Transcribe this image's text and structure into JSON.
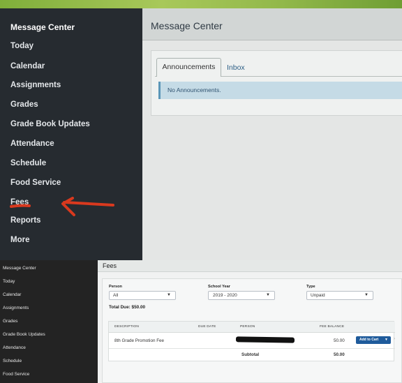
{
  "top": {
    "sidebar": {
      "items": [
        {
          "label": "Message Center"
        },
        {
          "label": "Today"
        },
        {
          "label": "Calendar"
        },
        {
          "label": "Assignments"
        },
        {
          "label": "Grades"
        },
        {
          "label": "Grade Book Updates"
        },
        {
          "label": "Attendance"
        },
        {
          "label": "Schedule"
        },
        {
          "label": "Food Service"
        },
        {
          "label": "Fees"
        },
        {
          "label": "Reports"
        },
        {
          "label": "More"
        }
      ]
    },
    "header": {
      "title": "Message Center"
    },
    "tabs": [
      {
        "label": "Announcements"
      },
      {
        "label": "Inbox"
      }
    ],
    "alert": "No Announcements.",
    "annotation_color": "#d9391e"
  },
  "bottom": {
    "sidebar": {
      "items": [
        {
          "label": "Message Center"
        },
        {
          "label": "Today"
        },
        {
          "label": "Calendar"
        },
        {
          "label": "Assignments"
        },
        {
          "label": "Grades"
        },
        {
          "label": "Grade Book Updates"
        },
        {
          "label": "Attendance"
        },
        {
          "label": "Schedule"
        },
        {
          "label": "Food Service"
        }
      ]
    },
    "header": {
      "title": "Fees"
    },
    "filters": {
      "person": {
        "label": "Person",
        "value": "All"
      },
      "school_year": {
        "label": "School Year",
        "value": "2019 - 2020"
      },
      "type": {
        "label": "Type",
        "value": "Unpaid"
      }
    },
    "total_due": "Total Due: $50.00",
    "table": {
      "columns": [
        "DESCRIPTION",
        "DUE DATE",
        "PERSON",
        "FEE BALANCE"
      ],
      "rows": [
        {
          "description": "8th Grade Promotion Fee",
          "due_date": "",
          "balance": "50.00",
          "action": "Add to Cart"
        }
      ],
      "subtotal_label": "Subtotal",
      "subtotal_value": "50.00"
    },
    "accent": "#1f5b9b"
  }
}
